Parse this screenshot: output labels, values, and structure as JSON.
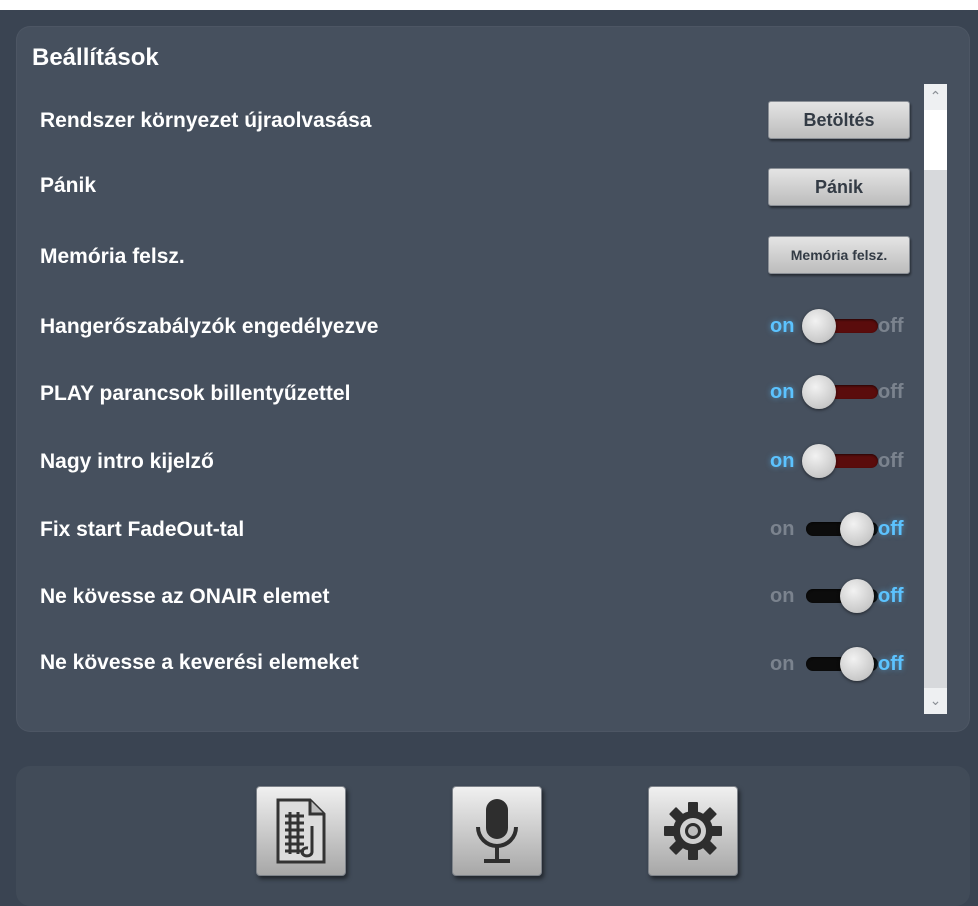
{
  "panel": {
    "title": "Beállítások"
  },
  "rows": [
    {
      "label": "Rendszer környezet újraolvasása",
      "button": "Betöltés"
    },
    {
      "label": "Pánik",
      "button": "Pánik"
    },
    {
      "label": "Memória felsz.",
      "button": "Memória felsz."
    },
    {
      "label": "Hangerőszabályzók engedélyezve",
      "state": "on"
    },
    {
      "label": "PLAY parancsok billentyűzettel",
      "state": "on"
    },
    {
      "label": "Nagy intro kijelző",
      "state": "on"
    },
    {
      "label": "Fix start FadeOut-tal",
      "state": "off"
    },
    {
      "label": "Ne kövesse az ONAIR elemet",
      "state": "off"
    },
    {
      "label": "Ne kövesse a keverési elemeket",
      "state": "off"
    }
  ],
  "toggle": {
    "on_label": "on",
    "off_label": "off"
  },
  "toolbar": {
    "icons": [
      "document-icon",
      "microphone-icon",
      "gear-icon"
    ]
  },
  "colors": {
    "active_label": "#5cc3ff",
    "on_track": "#5a0c0c",
    "off_track": "#0c0c0c"
  }
}
